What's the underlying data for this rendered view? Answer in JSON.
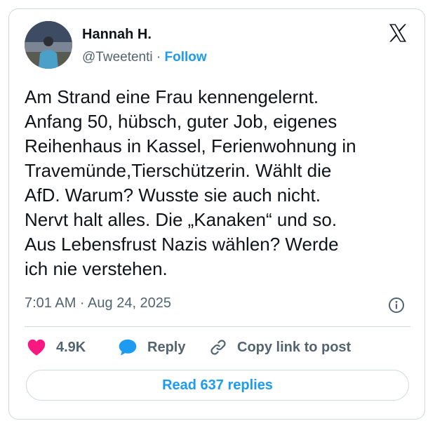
{
  "tweet": {
    "author_name": "Hannah H.",
    "handle": "@Tweetenti",
    "separator": " · ",
    "follow_label": "Follow",
    "text": "Am Strand eine Frau kennengelernt.\nAnfang 50, hübsch, guter Job, eigenes\nReihenhaus in Kassel,  Ferienwohnung in\nTravemünde,Tierschützerin. Wählt die\nAfD. Warum? Wusste sie auch nicht.\nNervt halt alles. Die „Kanaken“ und so.\nAus Lebensfrust Nazis wählen? Werde\nich nie verstehen.",
    "timestamp": "7:01 AM · Aug 24, 2025"
  },
  "actions": {
    "likes_count": "4.9K",
    "reply_label": "Reply",
    "copy_link_label": "Copy link to post"
  },
  "read_replies_label": "Read 637 replies",
  "icons": {
    "brand": "x-logo-icon",
    "info": "info-icon",
    "like": "heart-icon",
    "reply": "speech-bubble-icon",
    "copy": "link-icon"
  },
  "colors": {
    "accent": "#1d9bf0",
    "like": "#f91880",
    "muted": "#536471",
    "text": "#0f1419",
    "border": "#cfd9de"
  }
}
